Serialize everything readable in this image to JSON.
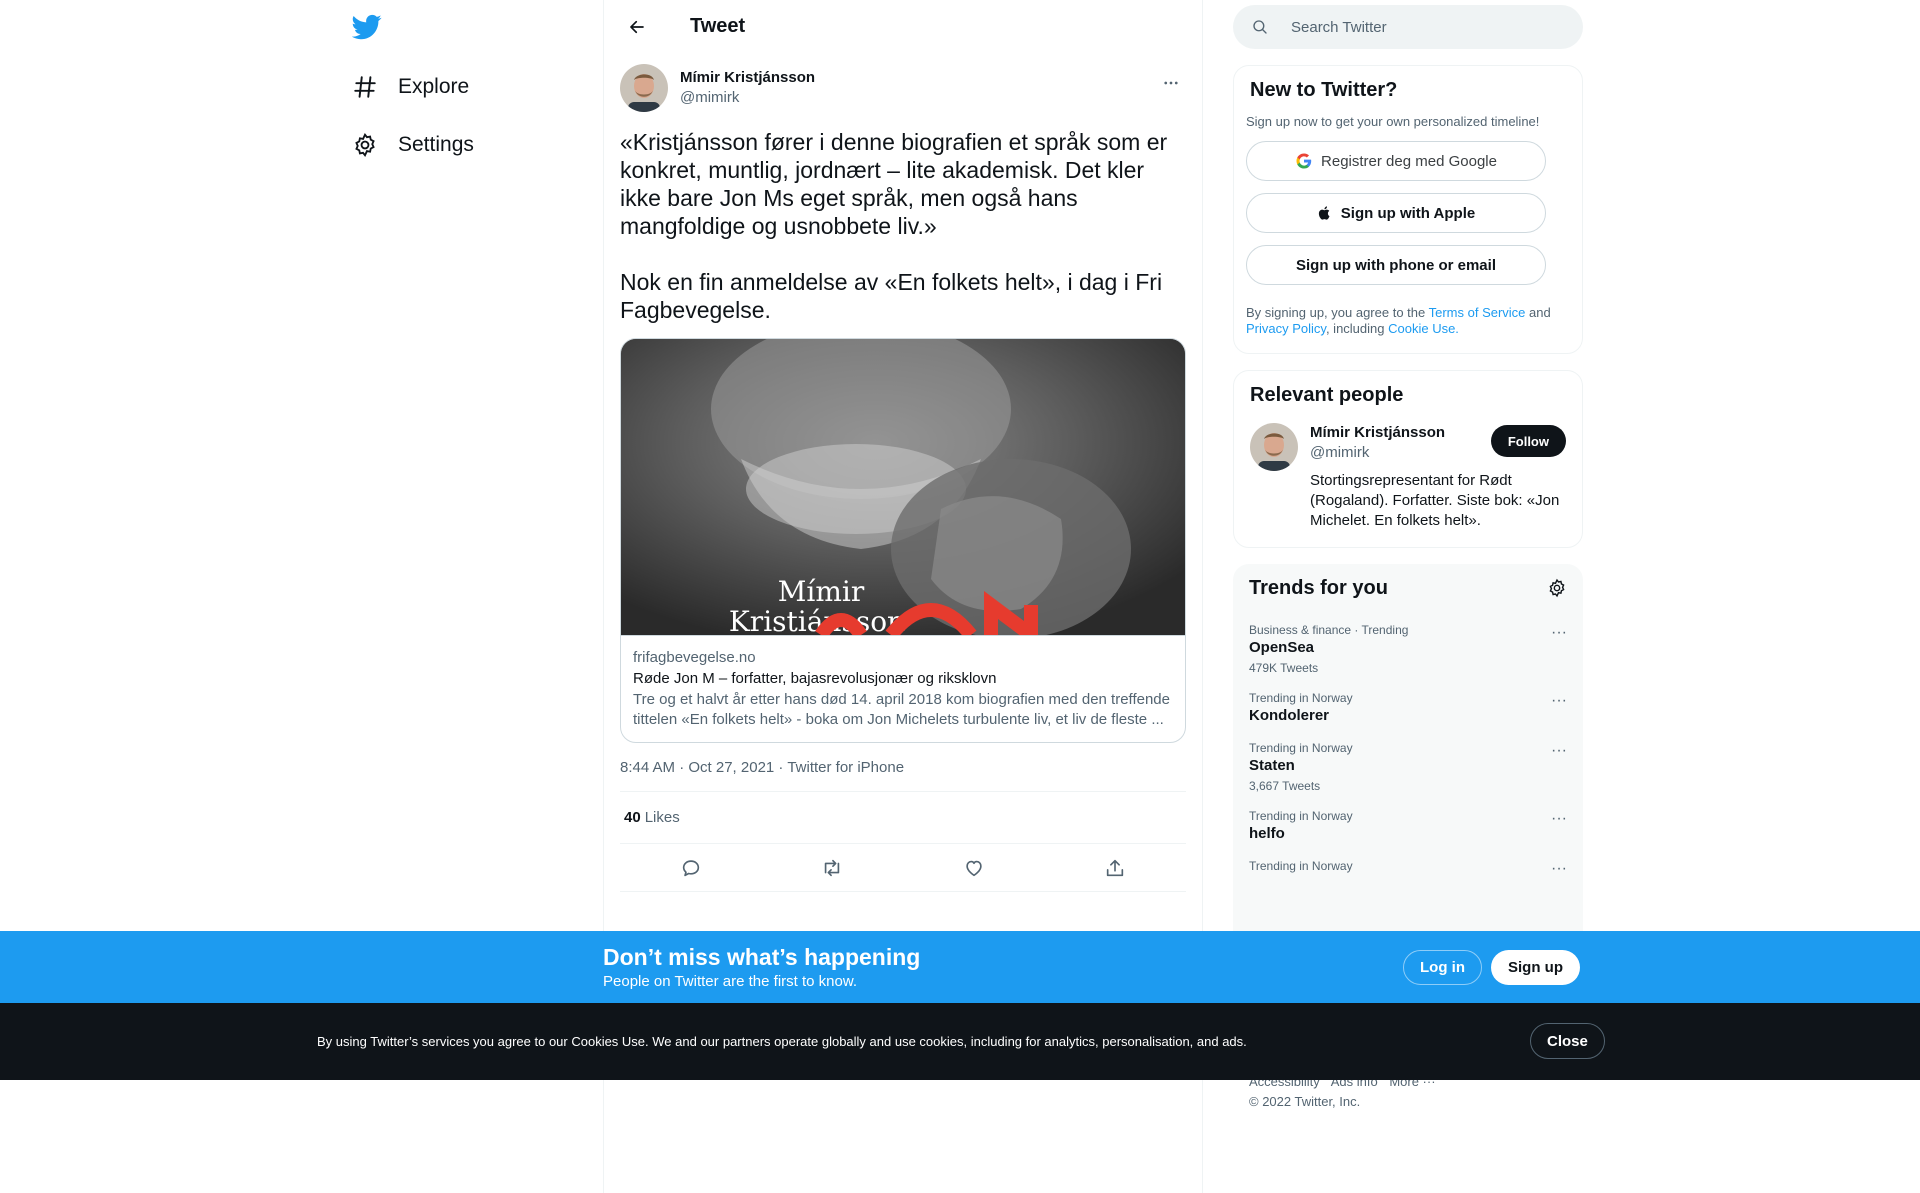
{
  "nav": {
    "logo": "twitter-bird",
    "items": [
      {
        "label": "Explore",
        "icon": "hashtag"
      },
      {
        "label": "Settings",
        "icon": "gear"
      }
    ]
  },
  "header": {
    "title": "Tweet"
  },
  "tweet": {
    "author_name": "Mímir Kristjánsson",
    "author_handle": "@mimirk",
    "text": "«Kristjánsson fører i denne biografien et språk som er konkret, muntlig, jordnært – lite akademisk. Det kler ikke bare Jon Ms eget språk, men også hans mangfoldige og usnobbete liv.»\n\nNok en fin anmeldelse av «En folkets helt», i dag i Fri Fagbevegelse.",
    "card": {
      "image_caption": "Mímir\nKristiánsson",
      "domain": "frifagbevegelse.no",
      "title": "Røde Jon M – forfatter, bajasrevolusjonær og riksklovn",
      "description": "Tre og et halvt år etter hans død 14. april 2018 kom biografien med den treffende tittelen «En folkets helt» - boka om Jon Michelets turbulente liv, et liv de fleste ..."
    },
    "meta": "8:44 AM · Oct 27, 2021 · Twitter for iPhone",
    "likes_count": "40",
    "likes_label": "Likes"
  },
  "search": {
    "placeholder": "Search Twitter"
  },
  "new_to_twitter": {
    "title": "New to Twitter?",
    "subtitle": "Sign up now to get your own personalized timeline!",
    "google_label": "Registrer deg med Google",
    "apple_label": "Sign up with Apple",
    "phone_label": "Sign up with phone or email",
    "terms_prefix": "By signing up, you agree to the ",
    "terms_link": "Terms of Service",
    "terms_and": " and ",
    "privacy_link": "Privacy Policy",
    "including": ", including ",
    "cookie_link": "Cookie Use."
  },
  "relevant": {
    "title": "Relevant people",
    "name": "Mímir Kristjánsson",
    "handle": "@mimirk",
    "bio": "Stortingsrepresentant for Rødt (Rogaland). Forfatter. Siste bok: «Jon Michelet. En folkets helt».",
    "follow_label": "Follow"
  },
  "trends": {
    "title": "Trends for you",
    "items": [
      {
        "meta": "Business & finance · Trending",
        "name": "OpenSea",
        "count": "479K Tweets"
      },
      {
        "meta": "Trending in Norway",
        "name": "Kondolerer",
        "count": ""
      },
      {
        "meta": "Trending in Norway",
        "name": "Staten",
        "count": "3,667 Tweets"
      },
      {
        "meta": "Trending in Norway",
        "name": "helfo",
        "count": ""
      },
      {
        "meta": "Trending in Norway",
        "name": "",
        "count": ""
      }
    ]
  },
  "footer": {
    "links": [
      "Accessibility",
      "Ads info",
      "More ···"
    ],
    "copyright": "© 2022 Twitter, Inc."
  },
  "bottom_bar": {
    "title": "Don’t miss what’s happening",
    "subtitle": "People on Twitter are the first to know.",
    "login_label": "Log in",
    "signup_label": "Sign up"
  },
  "cookie_bar": {
    "text": "By using Twitter’s services you agree to our Cookies Use. We and our partners operate globally and use cookies, including for analytics, personalisation, and ads.",
    "close_label": "Close"
  },
  "colors": {
    "brand": "#1d9bf0",
    "text": "#0f1419",
    "secondary": "#536471"
  }
}
